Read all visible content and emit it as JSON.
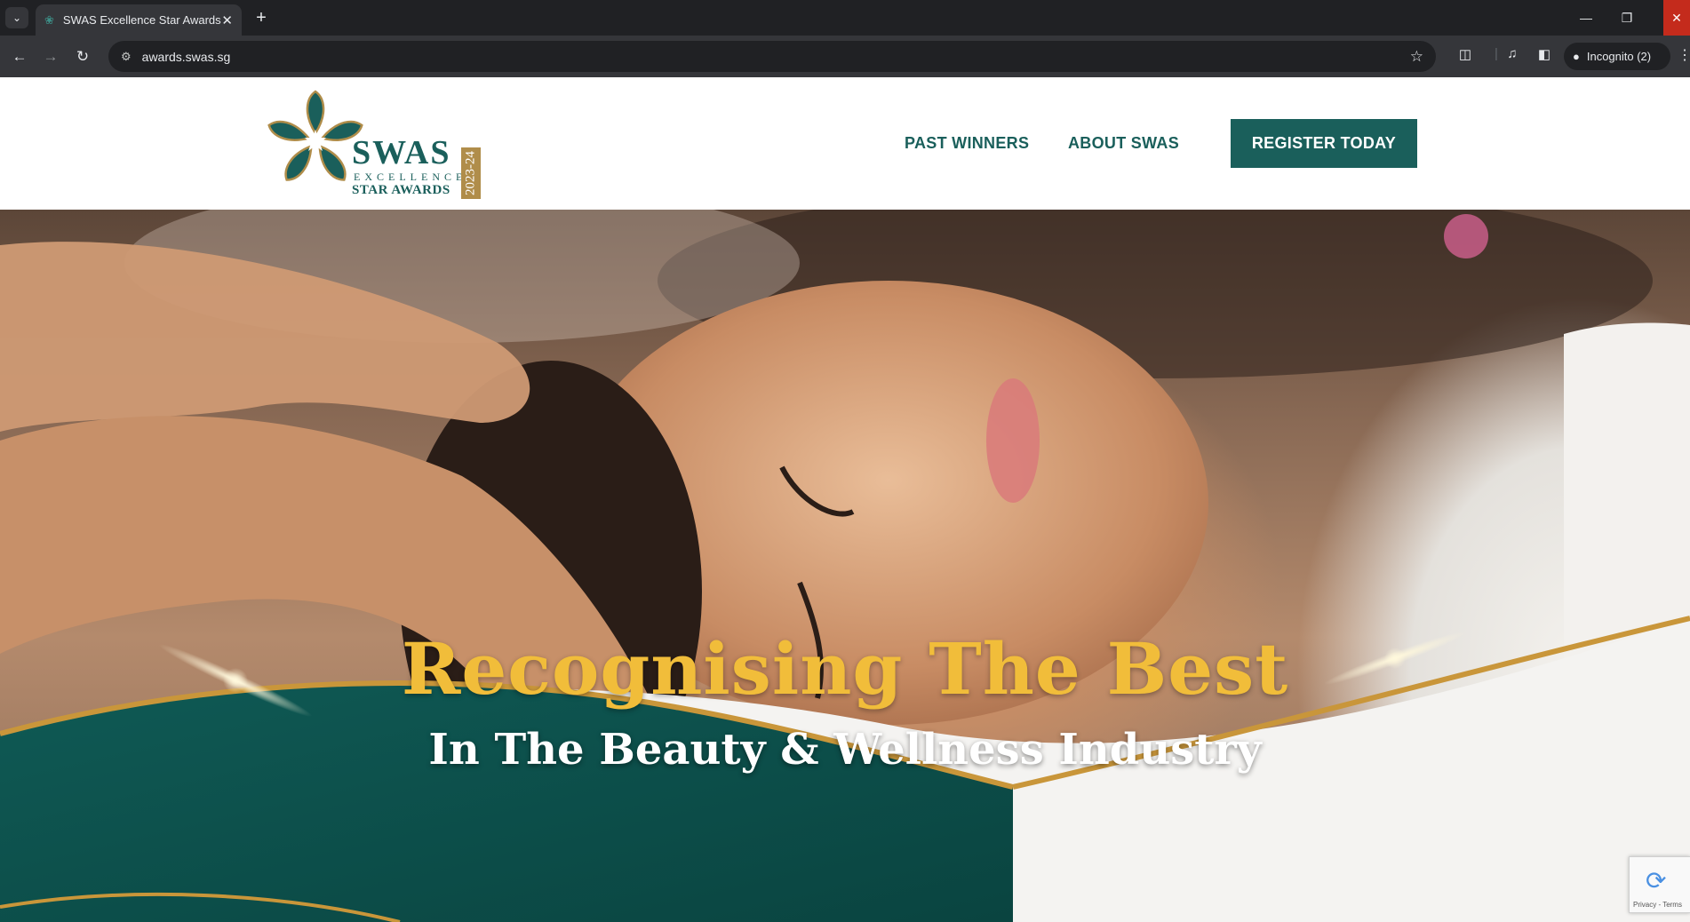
{
  "browser": {
    "tab_title": "SWAS Excellence Star Awards",
    "url": "awards.swas.sg",
    "incognito_label": "Incognito (2)"
  },
  "site": {
    "logo": {
      "name": "SWAS",
      "line2": "EXCELLENCE",
      "line3": "STAR AWARDS",
      "year": "2023-24"
    },
    "nav": {
      "past_winners": "PAST WINNERS",
      "about": "ABOUT SWAS",
      "register": "REGISTER TODAY"
    },
    "hero": {
      "title": "Recognising The Best",
      "subtitle": "In The Beauty & Wellness Industry"
    },
    "recaptcha": {
      "terms": "Privacy - Terms"
    }
  },
  "colors": {
    "brand_teal": "#1a5f5b",
    "gold": "#f1bd3a"
  }
}
